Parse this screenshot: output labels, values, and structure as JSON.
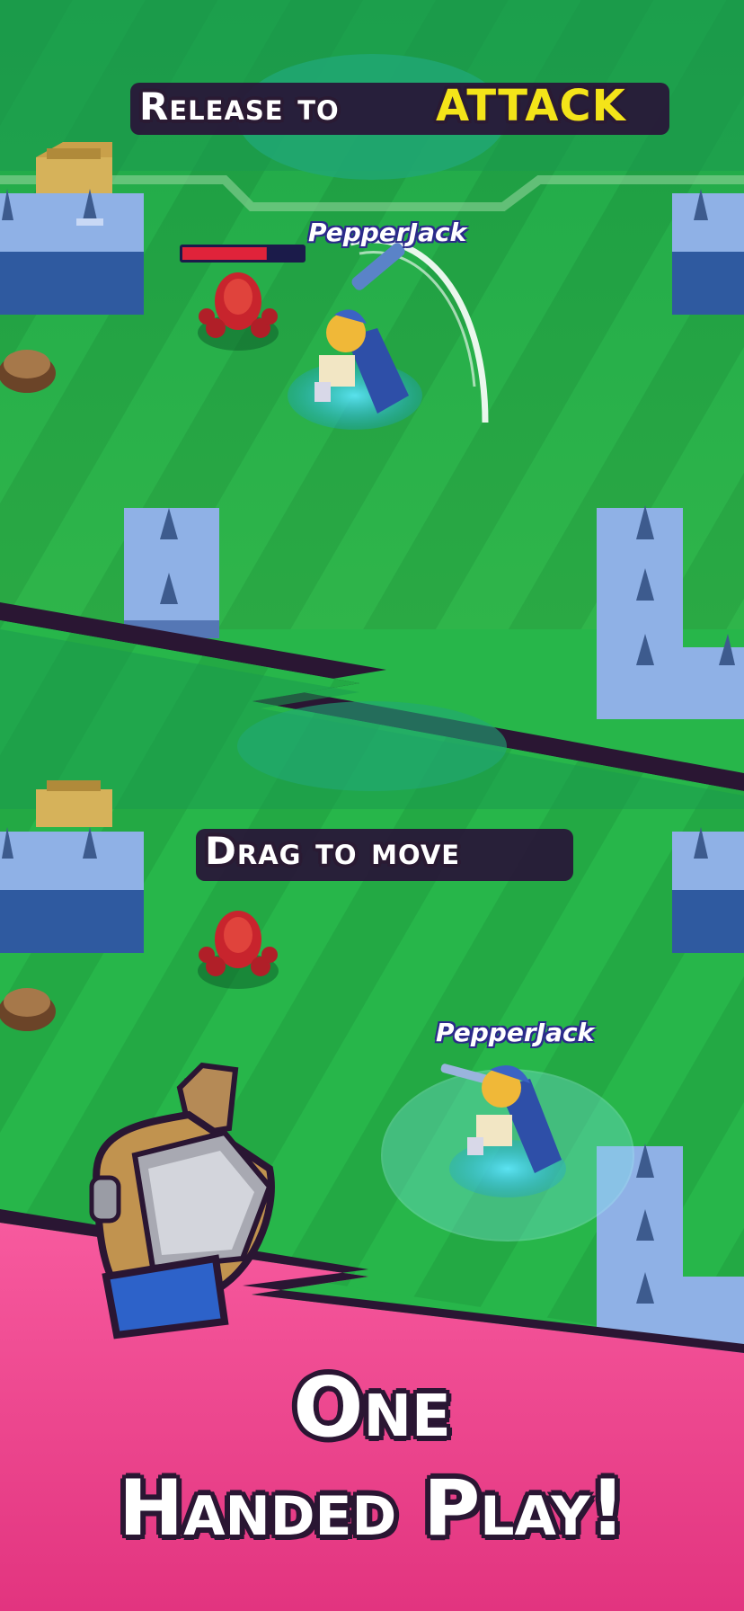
{
  "top_panel": {
    "caption_part1": "Release to",
    "caption_part2": "ATTACK",
    "player_name": "PepperJack",
    "enemy_health_fraction": 0.7
  },
  "bottom_panel": {
    "caption": "Drag to move",
    "player_name": "PepperJack"
  },
  "banner": {
    "line1": "One",
    "line2": "Handed Play!"
  },
  "colors": {
    "grass": "#27b64a",
    "banner_pink": "#f2448f",
    "caption_yellow": "#f4e419",
    "outline_dark": "#2a1633"
  },
  "icons": [
    "gauntlet-hand-icon",
    "spider-enemy-icon",
    "knight-hero-icon",
    "spike-block-icon",
    "crate-icon"
  ]
}
